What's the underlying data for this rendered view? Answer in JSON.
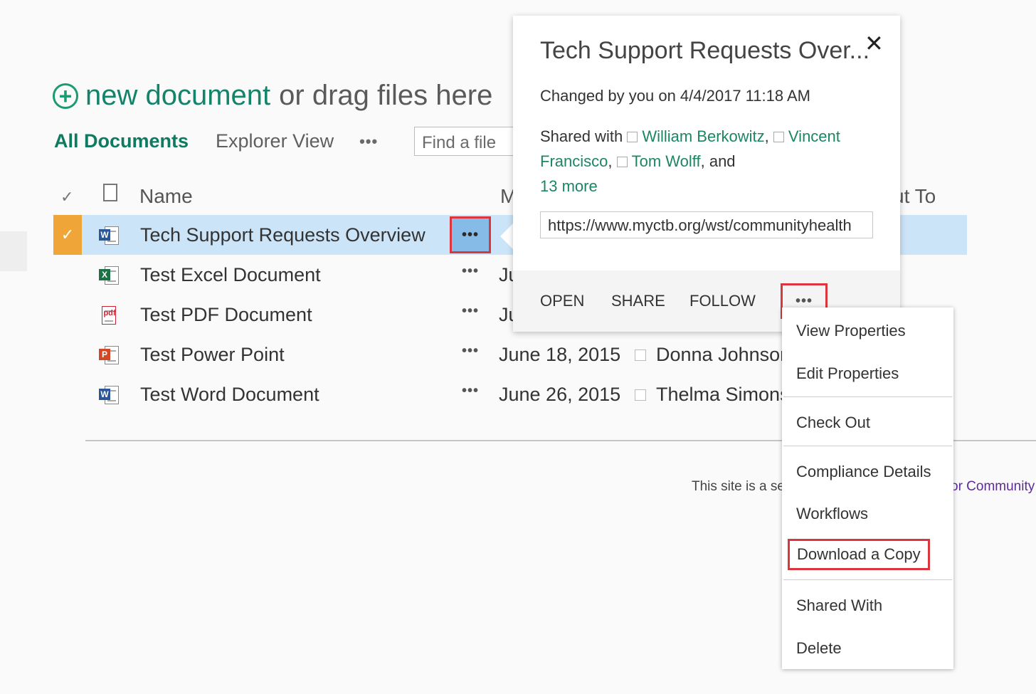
{
  "new_document": {
    "link_text": "new document",
    "rest_text": "or drag files here"
  },
  "views": {
    "active": "All Documents",
    "other": "Explorer View",
    "more": "•••"
  },
  "search": {
    "placeholder": "Find a file"
  },
  "columns": {
    "name": "Name",
    "modified": "M",
    "checked_out_to": "ut To"
  },
  "rows": [
    {
      "name": "Tech Support Requests Overview",
      "type": "word",
      "modified": "",
      "user": "",
      "selected": true
    },
    {
      "name": "Test Excel Document",
      "type": "excel",
      "modified": "Ju",
      "user": ""
    },
    {
      "name": "Test PDF Document",
      "type": "pdf",
      "modified": "Ju",
      "user": ""
    },
    {
      "name": "Test Power Point",
      "type": "ppt",
      "modified": "June 18, 2015",
      "user": "Donna Johnson"
    },
    {
      "name": "Test Word Document",
      "type": "word",
      "modified": "June 26, 2015",
      "user": "Thelma Simons"
    }
  ],
  "icon_badges": {
    "word": "W",
    "excel": "X",
    "ppt": "P",
    "pdf": "pdf"
  },
  "row_more": "•••",
  "footer": {
    "text": "This site is a ser",
    "link": "or Community"
  },
  "callout": {
    "title": "Tech Support Requests Over...",
    "close": "✕",
    "changed": "Changed by you on 4/4/2017 11:18 AM",
    "shared_prefix": "Shared with",
    "people": [
      "William Berkowitz",
      "Vincent Francisco",
      "Tom Wolff"
    ],
    "and": "and",
    "more": "13 more",
    "url": "https://www.myctb.org/wst/communityhealth",
    "actions": {
      "open": "OPEN",
      "share": "SHARE",
      "follow": "FOLLOW",
      "more": "•••"
    }
  },
  "menu": [
    "View Properties",
    "Edit Properties",
    "Check Out",
    "Compliance Details",
    "Workflows",
    "Download a Copy",
    "Shared With",
    "Delete"
  ],
  "colors": {
    "accent": "#13846a",
    "selected_row": "#cce4f7",
    "selection_box": "#f0a538",
    "highlight_border": "#d9373d"
  }
}
